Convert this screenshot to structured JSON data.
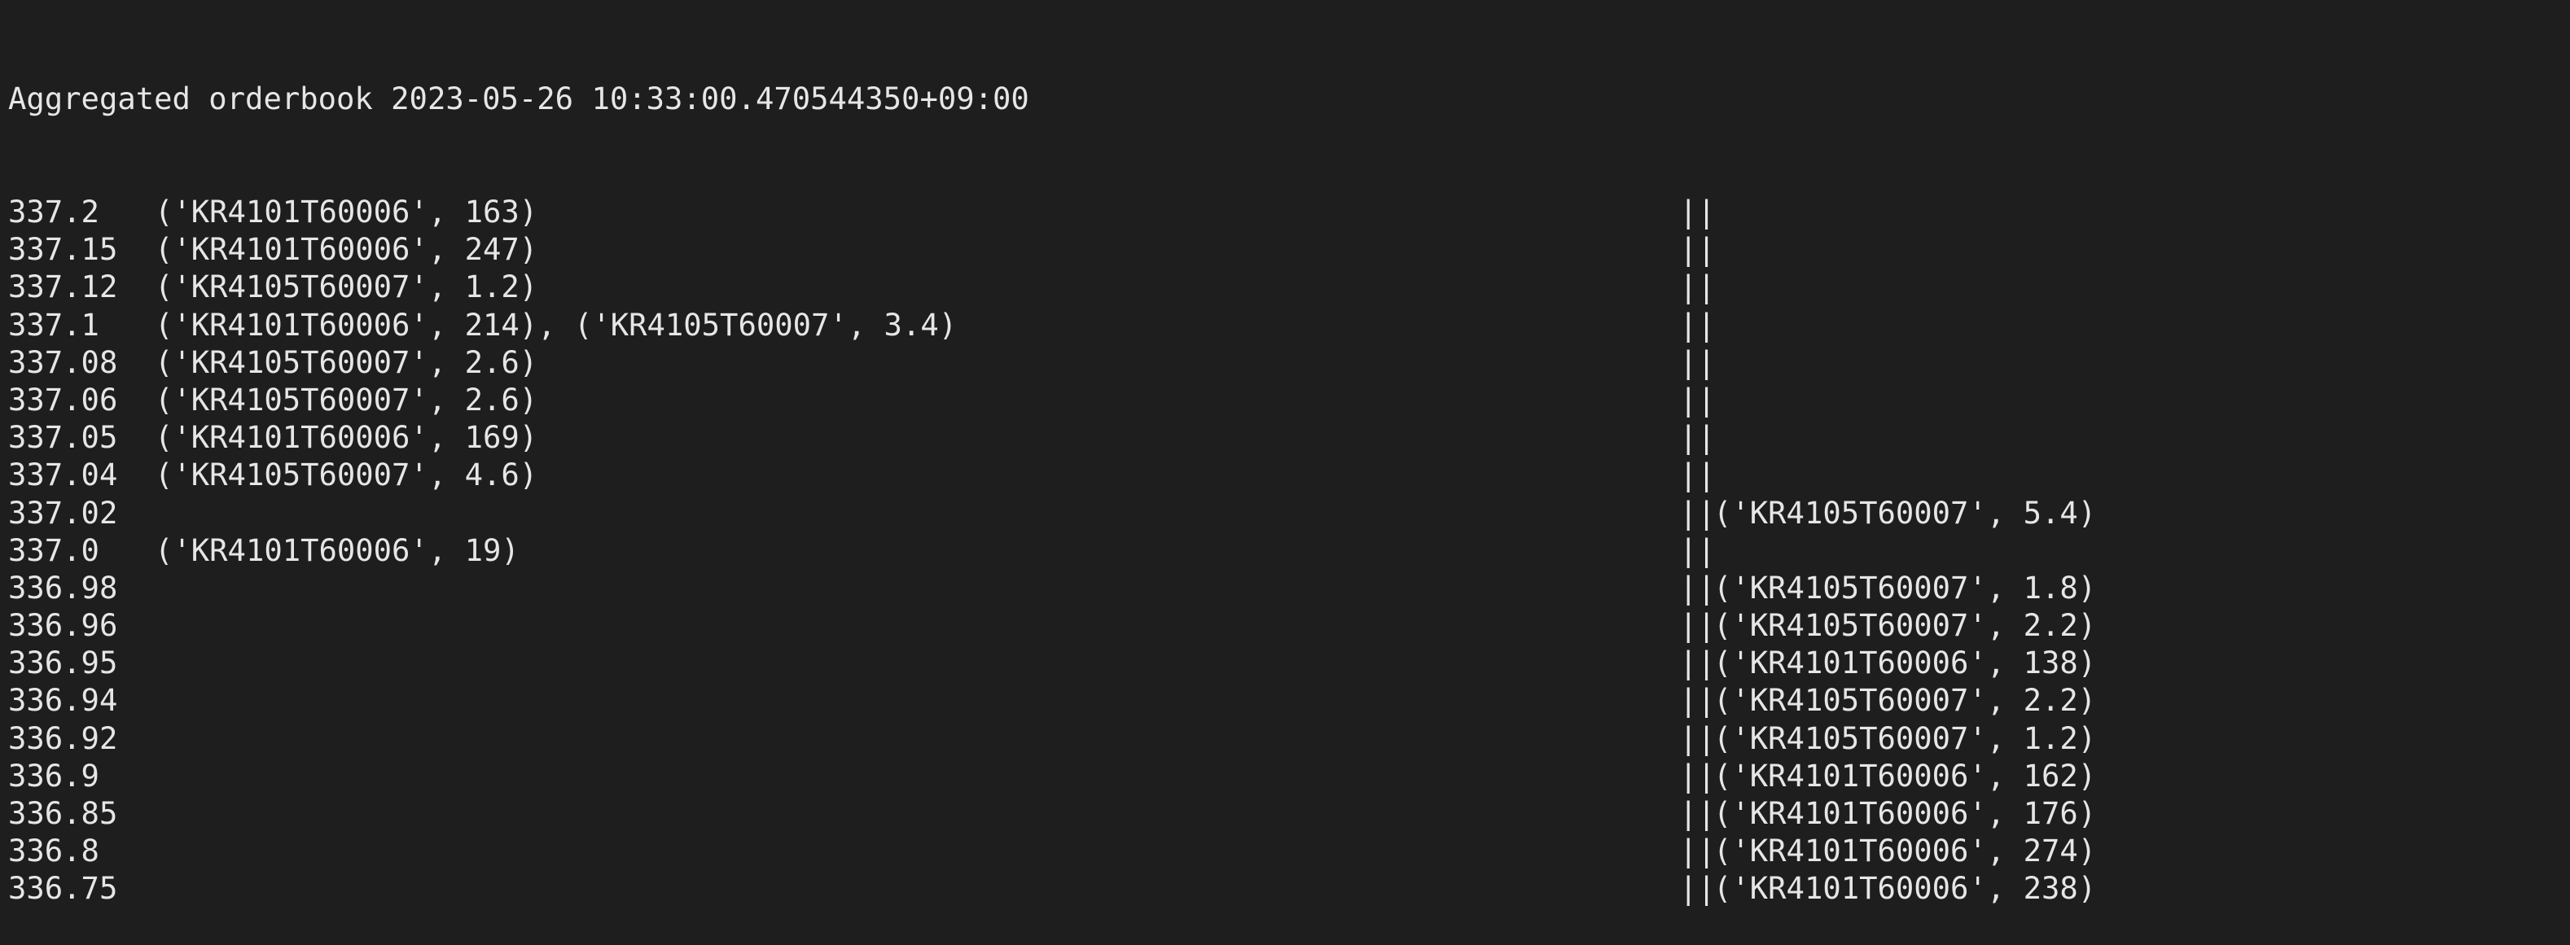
{
  "title": "Aggregated orderbook 2023-05-26 10:33:00.470544350+09:00",
  "separator": "||",
  "rows": [
    {
      "price": "337.2",
      "asks": "('KR4101T60006', 163)",
      "bids": ""
    },
    {
      "price": "337.15",
      "asks": "('KR4101T60006', 247)",
      "bids": ""
    },
    {
      "price": "337.12",
      "asks": "('KR4105T60007', 1.2)",
      "bids": ""
    },
    {
      "price": "337.1",
      "asks": "('KR4101T60006', 214), ('KR4105T60007', 3.4)",
      "bids": ""
    },
    {
      "price": "337.08",
      "asks": "('KR4105T60007', 2.6)",
      "bids": ""
    },
    {
      "price": "337.06",
      "asks": "('KR4105T60007', 2.6)",
      "bids": ""
    },
    {
      "price": "337.05",
      "asks": "('KR4101T60006', 169)",
      "bids": ""
    },
    {
      "price": "337.04",
      "asks": "('KR4105T60007', 4.6)",
      "bids": ""
    },
    {
      "price": "337.02",
      "asks": "",
      "bids": "('KR4105T60007', 5.4)"
    },
    {
      "price": "337.0",
      "asks": "('KR4101T60006', 19)",
      "bids": ""
    },
    {
      "price": "336.98",
      "asks": "",
      "bids": "('KR4105T60007', 1.8)"
    },
    {
      "price": "336.96",
      "asks": "",
      "bids": "('KR4105T60007', 2.2)"
    },
    {
      "price": "336.95",
      "asks": "",
      "bids": "('KR4101T60006', 138)"
    },
    {
      "price": "336.94",
      "asks": "",
      "bids": "('KR4105T60007', 2.2)"
    },
    {
      "price": "336.92",
      "asks": "",
      "bids": "('KR4105T60007', 1.2)"
    },
    {
      "price": "336.9",
      "asks": "",
      "bids": "('KR4101T60006', 162)"
    },
    {
      "price": "336.85",
      "asks": "",
      "bids": "('KR4101T60006', 176)"
    },
    {
      "price": "336.8",
      "asks": "",
      "bids": "('KR4101T60006', 274)"
    },
    {
      "price": "336.75",
      "asks": "",
      "bids": "('KR4101T60006', 238)"
    }
  ]
}
